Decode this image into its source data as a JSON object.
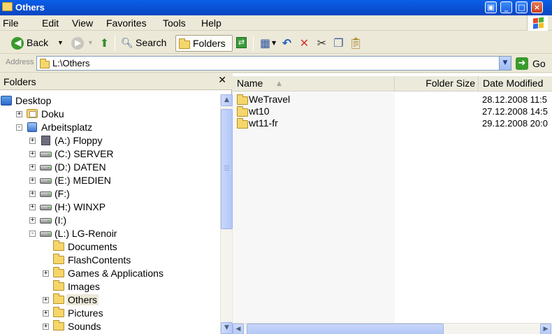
{
  "window": {
    "title": "Others"
  },
  "menu": [
    "File",
    "Edit",
    "View",
    "Favorites",
    "Tools",
    "Help"
  ],
  "toolbar": {
    "back_label": "Back",
    "search_label": "Search",
    "folders_label": "Folders"
  },
  "address": {
    "label": "Address",
    "value": "L:\\Others",
    "go_label": "Go"
  },
  "folders_pane": {
    "title": "Folders",
    "tree": [
      {
        "label": "Desktop",
        "icon": "desktop-icon",
        "expander": ""
      },
      {
        "label": "Doku",
        "icon": "my-documents-icon",
        "expander": "+"
      },
      {
        "label": "Arbeitsplatz",
        "icon": "my-computer-icon",
        "expander": "-"
      },
      {
        "label": "(A:) Floppy",
        "icon": "floppy-drive-icon",
        "expander": "+"
      },
      {
        "label": "(C:) SERVER",
        "icon": "drive-icon",
        "expander": "+"
      },
      {
        "label": "(D:) DATEN",
        "icon": "drive-icon",
        "expander": "+"
      },
      {
        "label": "(E:) MEDIEN",
        "icon": "drive-icon",
        "expander": "+"
      },
      {
        "label": "(F:)",
        "icon": "drive-icon",
        "expander": "+"
      },
      {
        "label": "(H:) WINXP",
        "icon": "drive-icon",
        "expander": "+"
      },
      {
        "label": "(I:)",
        "icon": "drive-icon",
        "expander": "+"
      },
      {
        "label": "(L:) LG-Renoir",
        "icon": "drive-icon",
        "expander": "-"
      },
      {
        "label": "Documents",
        "icon": "folder-icon",
        "expander": ""
      },
      {
        "label": "FlashContents",
        "icon": "folder-icon",
        "expander": ""
      },
      {
        "label": "Games & Applications",
        "icon": "folder-icon",
        "expander": "+"
      },
      {
        "label": "Images",
        "icon": "folder-icon",
        "expander": ""
      },
      {
        "label": "Others",
        "icon": "folder-icon",
        "expander": "+",
        "selected": true
      },
      {
        "label": "Pictures",
        "icon": "folder-icon",
        "expander": "+"
      },
      {
        "label": "Sounds",
        "icon": "folder-icon",
        "expander": "+"
      }
    ]
  },
  "file_list": {
    "columns": [
      "Name",
      "Folder Size",
      "Date Modified"
    ],
    "rows": [
      {
        "name": "WeTravel",
        "date": "28.12.2008 11:5"
      },
      {
        "name": "wt10",
        "date": "27.12.2008 14:5"
      },
      {
        "name": "wt11-fr",
        "date": "29.12.2008 20:0"
      }
    ]
  }
}
